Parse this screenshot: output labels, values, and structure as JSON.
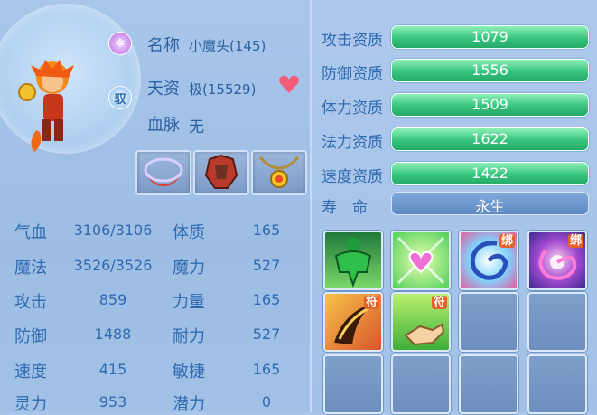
{
  "pet": {
    "name_label": "名称",
    "name_value": "小魔头(145)",
    "aptitude_label": "天资",
    "aptitude_value": "极(15529)",
    "bloodline_label": "血脉",
    "bloodline_value": "无",
    "badge_text": "驭"
  },
  "stats": {
    "left": [
      {
        "label": "气血",
        "value": "3106/3106"
      },
      {
        "label": "魔法",
        "value": "3526/3526"
      },
      {
        "label": "攻击",
        "value": "859"
      },
      {
        "label": "防御",
        "value": "1488"
      },
      {
        "label": "速度",
        "value": "415"
      },
      {
        "label": "灵力",
        "value": "953"
      }
    ],
    "right": [
      {
        "label": "体质",
        "value": "165"
      },
      {
        "label": "魔力",
        "value": "527"
      },
      {
        "label": "力量",
        "value": "165"
      },
      {
        "label": "耐力",
        "value": "527"
      },
      {
        "label": "敏捷",
        "value": "165"
      },
      {
        "label": "潜力",
        "value": "0"
      }
    ]
  },
  "aptitudes": [
    {
      "label": "攻击资质",
      "value": "1079"
    },
    {
      "label": "防御资质",
      "value": "1556"
    },
    {
      "label": "体力资质",
      "value": "1509"
    },
    {
      "label": "法力资质",
      "value": "1622"
    },
    {
      "label": "速度资质",
      "value": "1422"
    }
  ],
  "lifespan": {
    "label": "寿　命",
    "value": "永生"
  },
  "equipment": [
    "necklace-red-icon",
    "armor-red-icon",
    "amulet-gold-icon"
  ],
  "skills": [
    {
      "icon": "muscle-green-icon",
      "tag": ""
    },
    {
      "icon": "heart-sparkle-icon",
      "tag": ""
    },
    {
      "icon": "swirl-pink-icon",
      "tag": "绑"
    },
    {
      "icon": "vortex-purple-icon",
      "tag": "绑"
    },
    {
      "icon": "claw-fire-icon",
      "tag": "符"
    },
    {
      "icon": "hand-point-icon",
      "tag": "符"
    }
  ],
  "colors": {
    "accent": "#2f6ab0",
    "bar_green": "#37c57e",
    "bg": "#a9c6ea"
  }
}
